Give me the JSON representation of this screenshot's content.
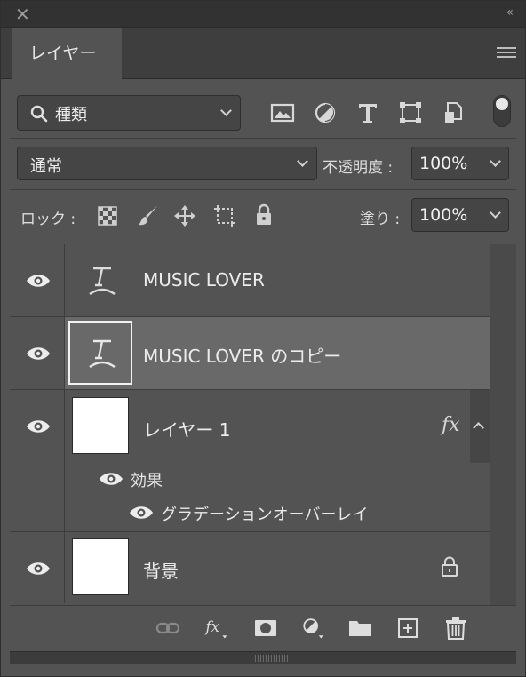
{
  "window": {
    "close_glyph": "✕",
    "collapse_glyph": "‹‹"
  },
  "tab": {
    "label": "レイヤー"
  },
  "filter": {
    "kind_label": "種類",
    "icons": [
      "image-filter-icon",
      "adjustment-filter-icon",
      "type-filter-icon",
      "shape-filter-icon",
      "smart-object-filter-icon"
    ]
  },
  "blend": {
    "mode": "通常",
    "opacity_label": "不透明度 :",
    "opacity_value": "100%"
  },
  "lock": {
    "label": "ロック :",
    "fill_label": "塗り :",
    "fill_value": "100%"
  },
  "layers": [
    {
      "name": "MUSIC LOVER",
      "type": "text",
      "selected": false
    },
    {
      "name": "MUSIC LOVER のコピー",
      "type": "text",
      "selected": true
    },
    {
      "name": "レイヤー 1",
      "type": "pixel",
      "selected": false,
      "fx": "fx",
      "effects_label": "効果",
      "effects": [
        "グラデーションオーバーレイ"
      ]
    },
    {
      "name": "背景",
      "type": "background",
      "selected": false,
      "locked": true
    }
  ],
  "colors": {
    "panel_bg": "#535353",
    "selected_row": "#696969",
    "thumb_white": "#ffffff"
  }
}
